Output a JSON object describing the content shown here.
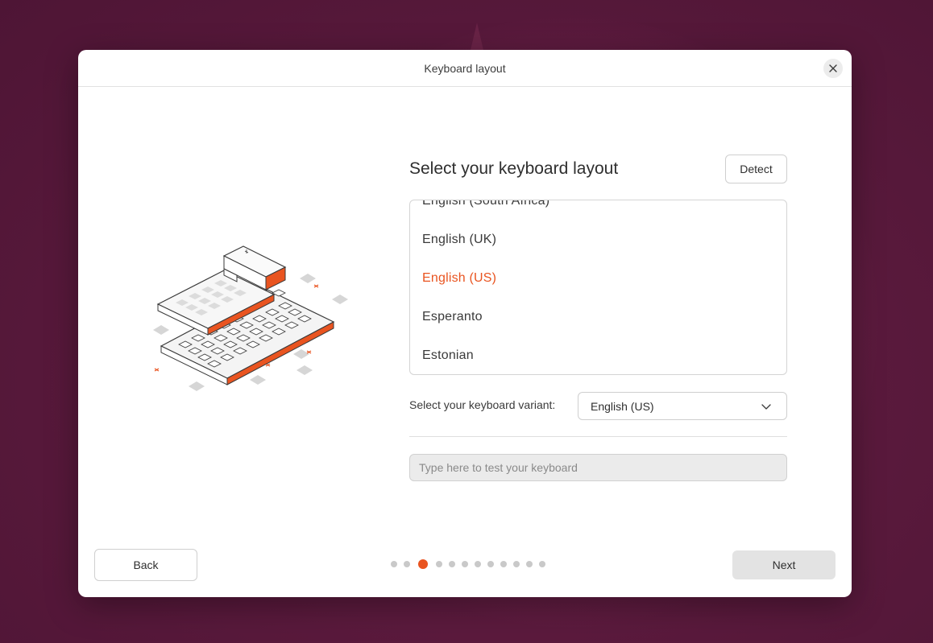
{
  "window": {
    "title": "Keyboard layout"
  },
  "heading": "Select your keyboard layout",
  "detect_label": "Detect",
  "layouts": [
    {
      "label": "English (South Africa)",
      "selected": false
    },
    {
      "label": "English (UK)",
      "selected": false
    },
    {
      "label": "English (US)",
      "selected": true
    },
    {
      "label": "Esperanto",
      "selected": false
    },
    {
      "label": "Estonian",
      "selected": false
    }
  ],
  "variant": {
    "label": "Select your keyboard variant:",
    "value": "English (US)"
  },
  "test_input": {
    "placeholder": "Type here to test your keyboard",
    "value": ""
  },
  "nav": {
    "back_label": "Back",
    "next_label": "Next",
    "step_count": 12,
    "current_step": 3
  },
  "colors": {
    "accent": "#e95420",
    "background": "#5b1a3d",
    "next_button": "#e3e3e3"
  },
  "icons": {
    "close": "close-icon",
    "dropdown": "chevron-down-icon",
    "illustration": "keyboard-illustration"
  }
}
